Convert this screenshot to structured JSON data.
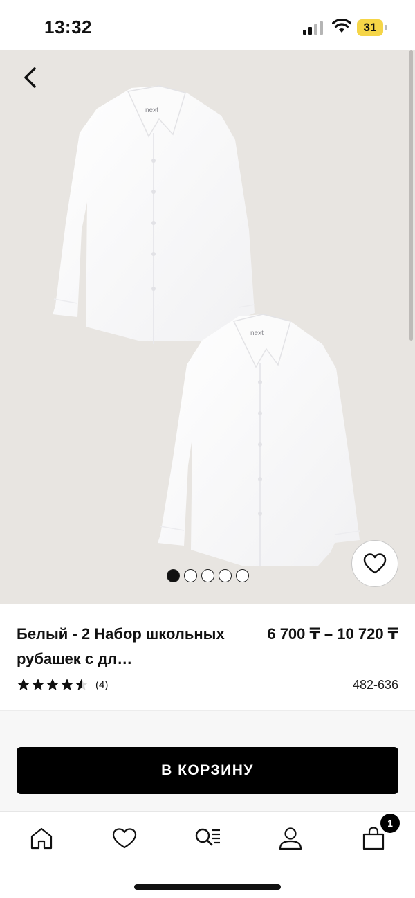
{
  "status_bar": {
    "time": "13:32",
    "battery": "31",
    "icons": [
      "signal-icon",
      "wifi-icon",
      "battery-icon"
    ]
  },
  "hero": {
    "image_count": 5,
    "active_index": 0,
    "brand_label": "next",
    "icons": [
      "chevron-left-icon",
      "heart-icon"
    ]
  },
  "product": {
    "title": "Белый - 2 Набор школьных рубашек с дл…",
    "price": "6 700 ₸ – 10 720 ₸",
    "rating": 4.5,
    "rating_count": "(4)",
    "sku": "482-636"
  },
  "cart": {
    "add_label": "В КОРЗИНУ"
  },
  "tab_bar": {
    "items": [
      {
        "name": "home",
        "icon": "home-icon"
      },
      {
        "name": "wishlist",
        "icon": "heart-icon"
      },
      {
        "name": "search",
        "icon": "search-list-icon"
      },
      {
        "name": "account",
        "icon": "user-icon"
      },
      {
        "name": "bag",
        "icon": "shopping-bag-icon"
      }
    ],
    "bag_badge": "1"
  },
  "colors": {
    "hero_bg": "#e8e5e1",
    "primary": "#000000",
    "battery": "#f5d547"
  }
}
